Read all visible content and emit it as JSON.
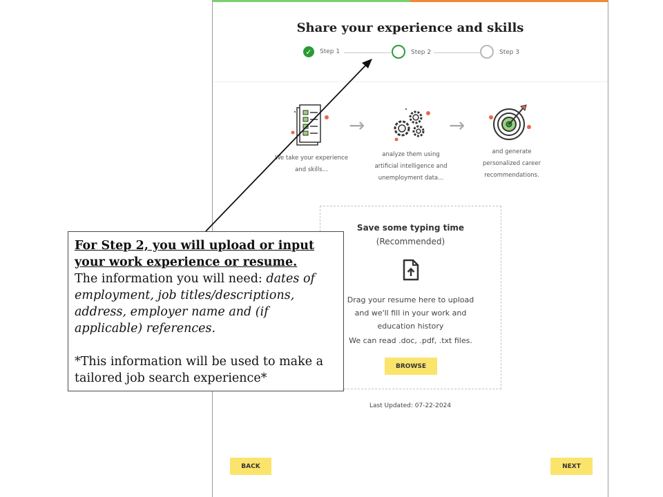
{
  "page": {
    "title": "Share your experience and skills",
    "steps": [
      {
        "label": "Step 1",
        "state": "complete"
      },
      {
        "label": "Step 2",
        "state": "active"
      },
      {
        "label": "Step 3",
        "state": "pending"
      }
    ],
    "illustrations": [
      {
        "icon": "checklist-document-icon",
        "caption_line1": "We take your experience",
        "caption_line2": "and skills..."
      },
      {
        "icon": "gears-icon",
        "caption_line1": "analyze them using",
        "caption_line2": "artificial intelligence and",
        "caption_line3": "unemployment data..."
      },
      {
        "icon": "target-icon",
        "caption_line1": "and generate",
        "caption_line2": "personalized career",
        "caption_line3": "recommendations."
      }
    ],
    "upload": {
      "title": "Save some typing time",
      "subtitle": "(Recommended)",
      "line1": "Drag your resume here to upload",
      "line2": "and we'll fill in your work and",
      "line3": "education history",
      "formats": "We can read .doc, .pdf, .txt files.",
      "browse_label": "BROWSE"
    },
    "last_updated": "Last Updated: 07-22-2024",
    "back_label": "BACK",
    "next_label": "NEXT"
  },
  "callout": {
    "heading_line1": "For Step 2, you will upload or input",
    "heading_line2": "your work experience or resume.",
    "info_prefix": "The information you will need: ",
    "info_italic": "dates of employment, job titles/descriptions, address, employer name and (if applicable) references.",
    "note": "*This information will be used to make a tailored job search experience*"
  },
  "colors": {
    "step_green": "#2a9a36",
    "button_yellow": "#fbe46c",
    "progress_green": "#7ccf6e",
    "progress_orange": "#f08a32"
  }
}
